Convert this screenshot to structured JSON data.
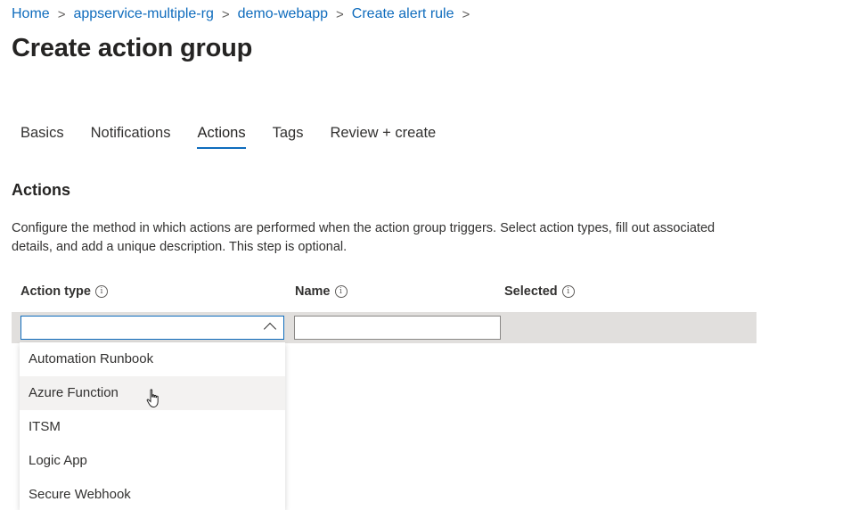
{
  "breadcrumb": {
    "items": [
      "Home",
      "appservice-multiple-rg",
      "demo-webapp",
      "Create alert rule"
    ],
    "separator": ">"
  },
  "page": {
    "title": "Create action group"
  },
  "tabs": [
    {
      "label": "Basics",
      "active": false
    },
    {
      "label": "Notifications",
      "active": false
    },
    {
      "label": "Actions",
      "active": true
    },
    {
      "label": "Tags",
      "active": false
    },
    {
      "label": "Review + create",
      "active": false
    }
  ],
  "section": {
    "title": "Actions",
    "description": "Configure the method in which actions are performed when the action group triggers. Select action types, fill out associated details, and add a unique description. This step is optional."
  },
  "columns": {
    "action_type": "Action type",
    "name": "Name",
    "selected": "Selected"
  },
  "action_type_select": {
    "value": "",
    "expanded": true
  },
  "name_input": {
    "value": ""
  },
  "dropdown": {
    "options": [
      "Automation Runbook",
      "Azure Function",
      "ITSM",
      "Logic App",
      "Secure Webhook"
    ],
    "hovered": "Azure Function"
  },
  "colors": {
    "accent": "#0f6cbd",
    "row_band": "#e1dfdd",
    "hover": "#f3f2f1"
  },
  "icons": {
    "info": "info-icon",
    "chevron": "chevron-up-icon",
    "cursor": "hand-pointer-cursor"
  }
}
